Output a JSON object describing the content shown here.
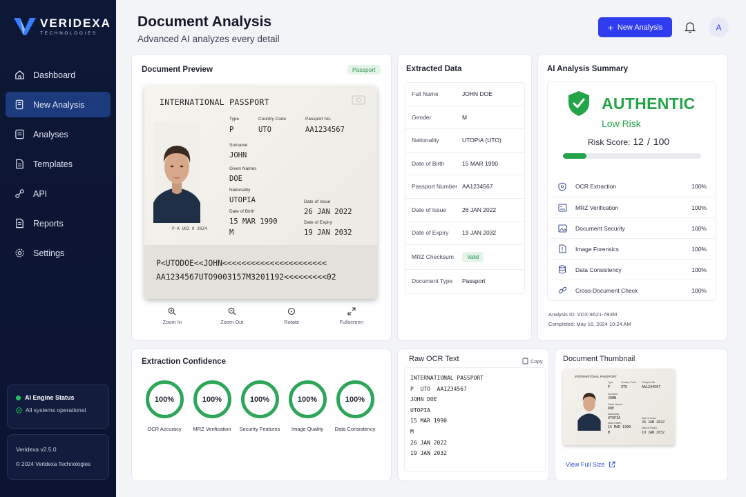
{
  "brand": {
    "name": "VERIDEXA",
    "tagline": "TECHNOLOGIES"
  },
  "sidebar": {
    "items": [
      {
        "label": "Dashboard",
        "icon": "home-icon"
      },
      {
        "label": "New Analysis",
        "icon": "document-search-icon"
      },
      {
        "label": "Analyses",
        "icon": "list-icon"
      },
      {
        "label": "Templates",
        "icon": "document-icon"
      },
      {
        "label": "API",
        "icon": "api-icon"
      },
      {
        "label": "Reports",
        "icon": "report-icon"
      },
      {
        "label": "Settings",
        "icon": "gear-icon"
      }
    ],
    "status_title": "AI Engine Status",
    "status_sub": "All systems operational",
    "version": "Veridexa v2.5.0",
    "copyright": "© 2024 Veridexa Technologies"
  },
  "header": {
    "title": "Document Analysis",
    "subtitle": "Advanced AI analyzes every detail",
    "new_button": "New Analysis",
    "avatar": "A"
  },
  "preview": {
    "title": "Document Preview",
    "badge": "Passport",
    "passport": {
      "heading": "INTERNATIONAL PASSPORT",
      "type_label": "Type",
      "type": "P",
      "country_label": "Country Code",
      "country": "UTO",
      "passno_label": "Passport No.",
      "passno": "AA1234567",
      "surname_label": "Surname",
      "surname": "JOHN",
      "given_label": "Given Names",
      "given": "DOE",
      "nationality_label": "Nationality",
      "nationality": "UTOPIA",
      "dob_label": "Date of Birth",
      "dob": "15 MAR 1990",
      "sex": "M",
      "issue_label": "Date of Issue",
      "issue": "26 JAN 2022",
      "expiry_label": "Date of Expiry",
      "expiry": "19 JAN 2032",
      "photo_caption": "P-A U02 0 2024",
      "mrz1": "P<UTODOE<<JOHN<<<<<<<<<<<<<<<<<<<<<<",
      "mrz2": "AA1234567UTO9003157M3201192<<<<<<<<<02"
    },
    "tools": [
      {
        "label": "Zoom In",
        "icon": "zoom-in-icon"
      },
      {
        "label": "Zoom Out",
        "icon": "zoom-out-icon"
      },
      {
        "label": "Rotate",
        "icon": "rotate-icon"
      },
      {
        "label": "Fullscreen",
        "icon": "fullscreen-icon"
      }
    ]
  },
  "extracted": {
    "title": "Extracted Data",
    "rows": [
      {
        "key": "Full Name",
        "value": "JOHN DOE"
      },
      {
        "key": "Gender",
        "value": "M"
      },
      {
        "key": "Nationality",
        "value": "UTOPIA (UTO)"
      },
      {
        "key": "Date of Birth",
        "value": "15 MAR 1990"
      },
      {
        "key": "Passport Number",
        "value": "AA1234567"
      },
      {
        "key": "Date of Issue",
        "value": "26 JAN 2022"
      },
      {
        "key": "Date of Expiry",
        "value": "19 JAN 2032"
      },
      {
        "key": "MRZ Checksum",
        "value": "Valid"
      },
      {
        "key": "Document Type",
        "value": "Passport"
      }
    ]
  },
  "summary": {
    "title": "AI Analysis Summary",
    "verdict": "AUTHENTIC",
    "risk_level": "Low Risk",
    "risk_label": "Risk Score:",
    "risk_score": "12",
    "risk_sep": "/",
    "risk_max": "100",
    "risk_fraction": 0.12,
    "checks": [
      {
        "label": "OCR Extraction",
        "value": "100%",
        "icon": "shield-icon"
      },
      {
        "label": "MRZ Verification",
        "value": "100%",
        "icon": "mrz-icon"
      },
      {
        "label": "Document Security",
        "value": "100%",
        "icon": "image-icon"
      },
      {
        "label": "Image Forensics",
        "value": "100%",
        "icon": "alert-icon"
      },
      {
        "label": "Data Consistency",
        "value": "100%",
        "icon": "database-icon"
      },
      {
        "label": "Cross-Document Check",
        "value": "100%",
        "icon": "link-icon"
      }
    ],
    "analysis_id": "Analysis ID: VDX-9A21-7B3M",
    "completed": "Completed: May 16, 2024 10:24 AM"
  },
  "confidence": {
    "title": "Extraction Confidence",
    "items": [
      {
        "label": "OCR Accuracy",
        "value": "100%"
      },
      {
        "label": "MRZ Verification",
        "value": "100%"
      },
      {
        "label": "Security Features",
        "value": "100%"
      },
      {
        "label": "Image Quality",
        "value": "100%"
      },
      {
        "label": "Data Consistency",
        "value": "100%"
      }
    ]
  },
  "ocr": {
    "title": "Raw OCR Text",
    "copy": "Copy",
    "lines": [
      "INTERNATIONAL PASSPORT",
      "P  UTO  AA1234567",
      "JOHN DOE",
      "UTOPIA",
      "15 MAR 1990",
      "M",
      "26 JAN 2022",
      "19 JAN 2032"
    ]
  },
  "thumbnail": {
    "title": "Document Thumbnail",
    "view_full": "View Full Size"
  }
}
